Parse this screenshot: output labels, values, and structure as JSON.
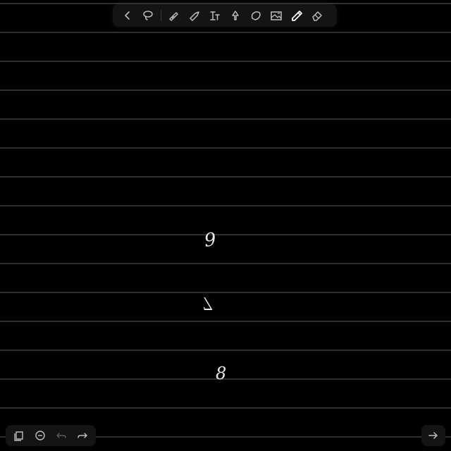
{
  "toolbar": {
    "tools": [
      {
        "icon": "chevron-left-icon"
      },
      {
        "icon": "lasso-icon"
      },
      {
        "icon": "pen-icon"
      },
      {
        "icon": "highlighter-icon"
      },
      {
        "icon": "text-icon"
      },
      {
        "icon": "shapes-icon"
      },
      {
        "icon": "sticky-note-icon"
      },
      {
        "icon": "image-icon"
      },
      {
        "icon": "marker-icon",
        "active": true
      },
      {
        "icon": "eraser-icon"
      }
    ]
  },
  "canvas": {
    "background": "#000000",
    "line_color": "#2e2e2e",
    "ink_color": "#e6e6e6",
    "handwriting": [
      "9",
      "7",
      "8"
    ]
  },
  "bottom_toolbar": {
    "tools": [
      {
        "icon": "pages-icon"
      },
      {
        "icon": "zoom-out-icon"
      },
      {
        "icon": "undo-icon"
      },
      {
        "icon": "redo-icon"
      }
    ]
  },
  "navigation": {
    "next_icon": "arrow-right-icon"
  }
}
